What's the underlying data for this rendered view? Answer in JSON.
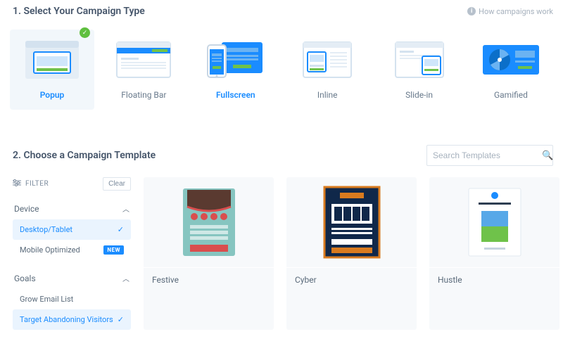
{
  "section1": {
    "title": "1. Select Your Campaign Type",
    "help": "How campaigns work"
  },
  "types": [
    {
      "label": "Popup"
    },
    {
      "label": "Floating Bar"
    },
    {
      "label": "Fullscreen"
    },
    {
      "label": "Inline"
    },
    {
      "label": "Slide-in"
    },
    {
      "label": "Gamified"
    }
  ],
  "section2": {
    "title": "2. Choose a Campaign Template",
    "search_placeholder": "Search Templates"
  },
  "filterbar": {
    "label": "FILTER",
    "clear": "Clear"
  },
  "filters": {
    "deviceHeader": "Device",
    "desktop": "Desktop/Tablet",
    "mobile": "Mobile Optimized",
    "newBadge": "NEW",
    "goalsHeader": "Goals",
    "growEmail": "Grow Email List",
    "targetAbandon": "Target Abandoning Visitors"
  },
  "templates": [
    {
      "name": "Festive"
    },
    {
      "name": "Cyber"
    },
    {
      "name": "Hustle"
    }
  ]
}
